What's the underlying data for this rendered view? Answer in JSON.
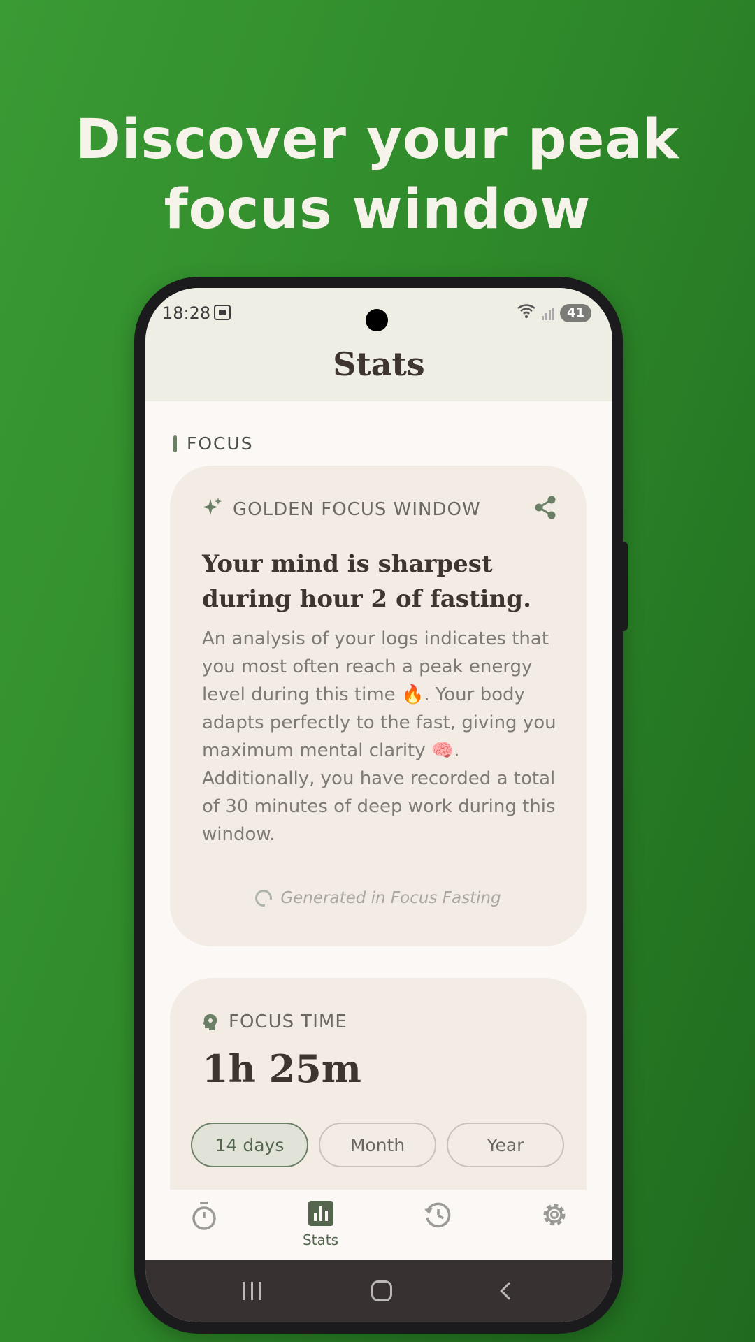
{
  "headline": {
    "line1": "Discover your peak",
    "line2": "focus window"
  },
  "status_bar": {
    "time": "18:28",
    "battery": "41"
  },
  "header": {
    "title": "Stats"
  },
  "section": {
    "label": "FOCUS"
  },
  "golden_card": {
    "label": "GOLDEN FOCUS WINDOW",
    "title": "Your mind is sharpest during hour 2 of fasting.",
    "body": "An analysis of your logs indicates that you most often reach a peak energy level during this time 🔥. Your body adapts perfectly to the fast, giving you maximum mental clarity 🧠. Additionally, you have recorded a total of 30 minutes of deep work during this window.",
    "footer": "Generated in Focus Fasting"
  },
  "focus_time_card": {
    "label": "FOCUS TIME",
    "value": "1h 25m",
    "ranges": [
      "14 days",
      "Month",
      "Year"
    ],
    "selected_range": "14 days"
  },
  "nav": {
    "items": [
      {
        "label": "",
        "icon": "timer-icon"
      },
      {
        "label": "Stats",
        "icon": "stats-icon"
      },
      {
        "label": "",
        "icon": "history-icon"
      },
      {
        "label": "",
        "icon": "settings-icon"
      }
    ]
  },
  "colors": {
    "background": "#2f8a2a",
    "accent": "#6b7f67",
    "card": "#f3ece5",
    "text_dark": "#3f3530"
  }
}
